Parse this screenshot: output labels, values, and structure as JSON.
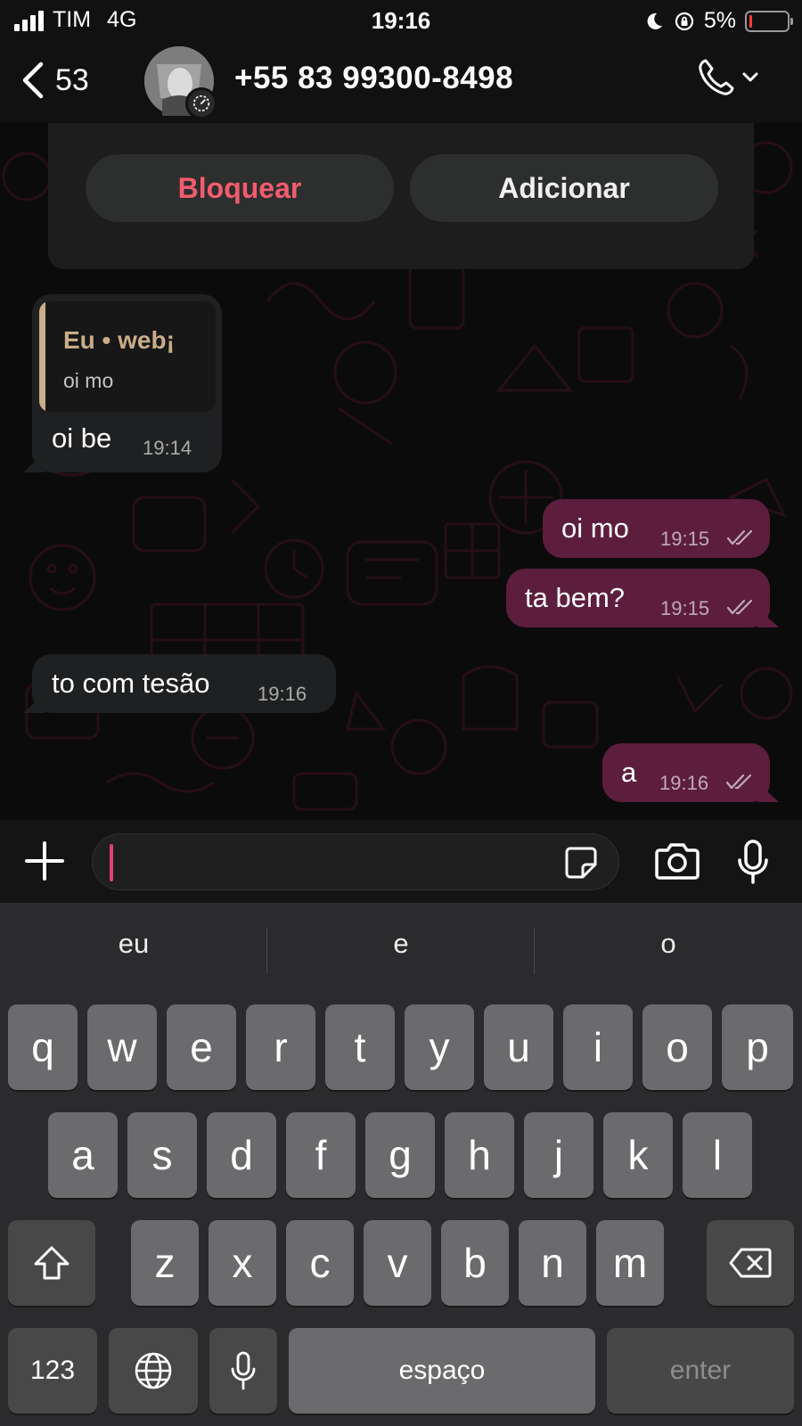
{
  "status": {
    "carrier": "TIM",
    "network": "4G",
    "time": "19:16",
    "battery_percent": "5%",
    "battery_level": 0.05,
    "battery_color": "#ff3b30"
  },
  "header": {
    "back_count": "53",
    "contact": "+55 83 99300-8498",
    "avatar_badge_icon": "timer-icon",
    "call_icon": "phone-icon"
  },
  "card": {
    "block_label": "Bloquear",
    "add_label": "Adicionar"
  },
  "messages": {
    "m1": {
      "quote_author": "Eu • web¡",
      "quote_text": "oi mo",
      "text": "oi be",
      "time": "19:14"
    },
    "m2": {
      "text": "oi mo",
      "time": "19:15"
    },
    "m3": {
      "text": "ta bem?",
      "time": "19:15"
    },
    "m4": {
      "text": "to com tesão",
      "time": "19:16"
    },
    "m5": {
      "text": "a",
      "time": "19:16"
    }
  },
  "input": {
    "value": ""
  },
  "keyboard": {
    "suggestions": [
      "eu",
      "e",
      "o"
    ],
    "row1": [
      "q",
      "w",
      "e",
      "r",
      "t",
      "y",
      "u",
      "i",
      "o",
      "p"
    ],
    "row2": [
      "a",
      "s",
      "d",
      "f",
      "g",
      "h",
      "j",
      "k",
      "l"
    ],
    "row3": [
      "z",
      "x",
      "c",
      "v",
      "b",
      "n",
      "m"
    ],
    "numbers_label": "123",
    "space_label": "espaço",
    "enter_label": "enter"
  },
  "colors": {
    "outgoing_bubble": "#5c1e3c",
    "incoming_bubble": "#1f2021",
    "block_text": "#f15c6d",
    "quote_accent": "#c8ae89",
    "caret": "#e0407a"
  }
}
